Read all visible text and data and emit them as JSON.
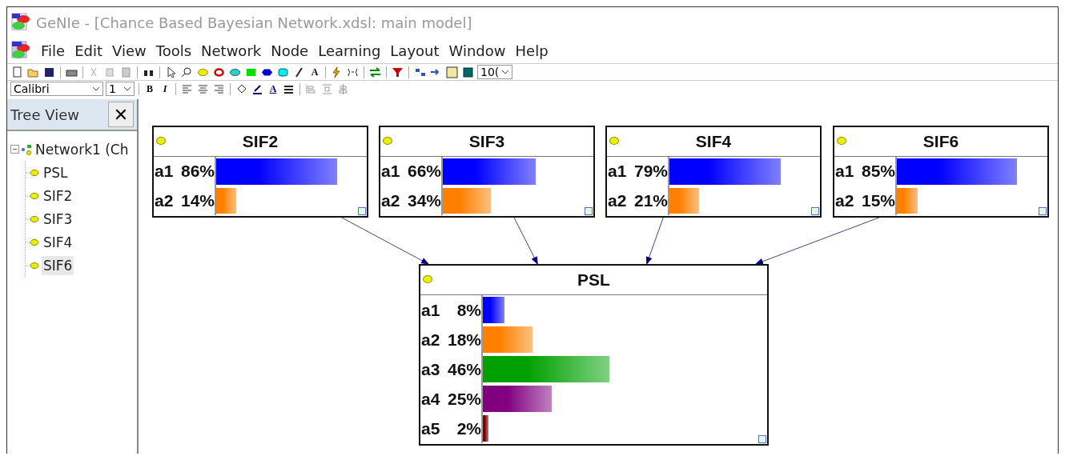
{
  "window": {
    "title": "GeNIe - [Chance Based Bayesian Network.xdsl: main model]"
  },
  "menu": [
    "File",
    "Edit",
    "View",
    "Tools",
    "Network",
    "Node",
    "Learning",
    "Layout",
    "Window",
    "Help"
  ],
  "toolbar": {
    "text_tool": "A",
    "zoom": "10("
  },
  "format_bar": {
    "font": "Calibri",
    "size": "1",
    "bold": "B",
    "italic": "I",
    "font_color": "A"
  },
  "tree_view": {
    "title": "Tree View",
    "close": "✕",
    "root": {
      "label": "Network1 (Ch",
      "expanded": true,
      "children": [
        {
          "label": "PSL",
          "selected": false
        },
        {
          "label": "SIF2",
          "selected": false
        },
        {
          "label": "SIF3",
          "selected": false
        },
        {
          "label": "SIF4",
          "selected": false
        },
        {
          "label": "SIF6",
          "selected": true
        }
      ]
    }
  },
  "nodes": [
    {
      "name": "SIF2",
      "states": [
        {
          "state": "a1",
          "value": "86%",
          "level": 0.86,
          "color": "#0000ff"
        },
        {
          "state": "a2",
          "value": "14%",
          "level": 0.14,
          "color": "#ff8000"
        }
      ]
    },
    {
      "name": "SIF3",
      "states": [
        {
          "state": "a1",
          "value": "66%",
          "level": 0.66,
          "color": "#0000ff"
        },
        {
          "state": "a2",
          "value": "34%",
          "level": 0.34,
          "color": "#ff8000"
        }
      ]
    },
    {
      "name": "SIF4",
      "states": [
        {
          "state": "a1",
          "value": "79%",
          "level": 0.79,
          "color": "#0000ff"
        },
        {
          "state": "a2",
          "value": "21%",
          "level": 0.21,
          "color": "#ff8000"
        }
      ]
    },
    {
      "name": "SIF6",
      "states": [
        {
          "state": "a1",
          "value": "85%",
          "level": 0.85,
          "color": "#0000ff"
        },
        {
          "state": "a2",
          "value": "15%",
          "level": 0.15,
          "color": "#ff8000"
        }
      ]
    },
    {
      "name": "PSL",
      "states": [
        {
          "state": "a1",
          "value": "8%",
          "level": 0.08,
          "color": "#0000ff"
        },
        {
          "state": "a2",
          "value": "18%",
          "level": 0.18,
          "color": "#ff8000"
        },
        {
          "state": "a3",
          "value": "46%",
          "level": 0.46,
          "color": "#00a000"
        },
        {
          "state": "a4",
          "value": "25%",
          "level": 0.25,
          "color": "#800080"
        },
        {
          "state": "a5",
          "value": "2%",
          "level": 0.02,
          "color": "#800000"
        }
      ]
    }
  ]
}
